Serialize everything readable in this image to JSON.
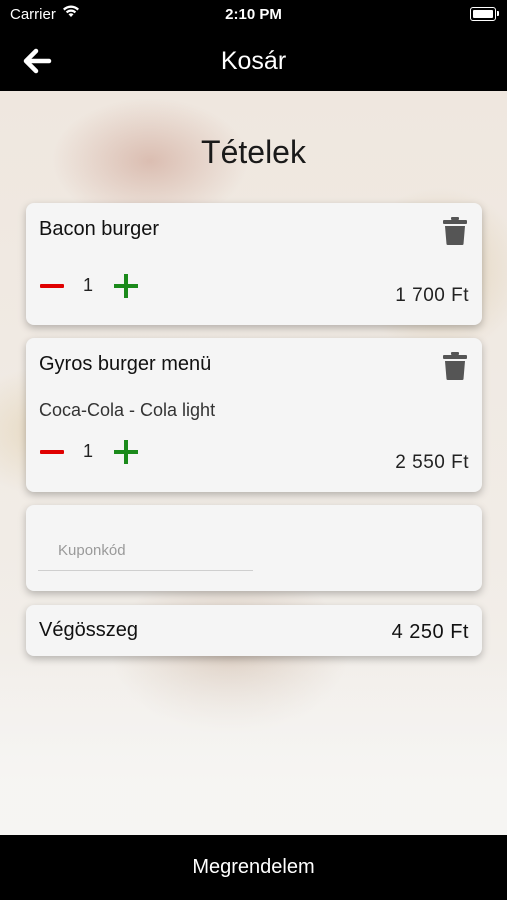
{
  "status_bar": {
    "carrier": "Carrier",
    "time": "2:10 PM"
  },
  "nav": {
    "title": "Kosár",
    "back_icon": "arrow-left-icon"
  },
  "section_title": "Tételek",
  "cart_items": [
    {
      "name": "Bacon burger",
      "description": "",
      "quantity": "1",
      "price": "1 700 Ft"
    },
    {
      "name": "Gyros burger menü",
      "description": "Coca-Cola - Cola light",
      "quantity": "1",
      "price": "2 550 Ft"
    }
  ],
  "coupon": {
    "placeholder": "Kuponkód",
    "value": ""
  },
  "total": {
    "label": "Végösszeg",
    "value": "4 250 Ft"
  },
  "order_button": {
    "label": "Megrendelem"
  },
  "colors": {
    "minus": "#e00000",
    "plus": "#1b8a1b",
    "bars": "#000000"
  }
}
